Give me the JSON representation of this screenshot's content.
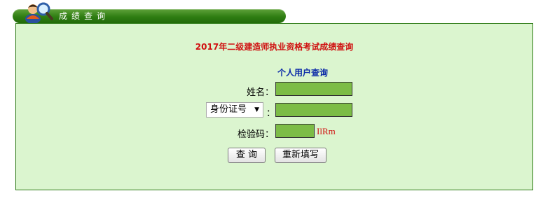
{
  "header": {
    "title": "成绩查询"
  },
  "form": {
    "page_title": "2017年二级建造师执业资格考试成绩查询",
    "section_title": "个人用户查询",
    "name_label": "姓名：",
    "name_value": "",
    "id_type_selected": "身份证号",
    "id_colon": "：",
    "id_value": "",
    "captcha_label": "检验码：",
    "captcha_value": "",
    "captcha_text": "IlRm",
    "query_button": "查 询",
    "reset_button": "重新填写"
  },
  "colors": {
    "accent_green": "#2f7d12",
    "panel_background": "#dbf5cf",
    "input_background": "#7cbc46",
    "title_red": "#d01010",
    "subtitle_blue": "#0b2aa8"
  },
  "icons": [
    "user-search-icon",
    "chevron-down-icon"
  ]
}
